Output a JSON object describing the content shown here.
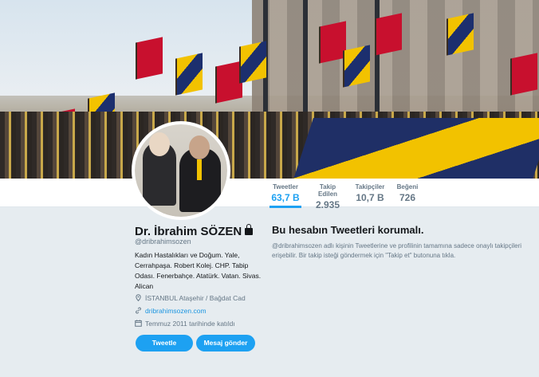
{
  "colors": {
    "accent": "#1da1f2",
    "link": "#1b95e0",
    "page_background": "#e6ecf0",
    "muted_text": "#657786"
  },
  "nav": {
    "stats": [
      {
        "label": "Tweetler",
        "value": "63,7 B",
        "active": true
      },
      {
        "label": "Takip Edilen",
        "value": "2.935",
        "active": false
      },
      {
        "label": "Takipçiler",
        "value": "10,7 B",
        "active": false
      },
      {
        "label": "Beğeni",
        "value": "726",
        "active": false
      }
    ]
  },
  "profile": {
    "name": "Dr. İbrahim SÖZEN",
    "handle": "@dribrahimsozen",
    "bio": "Kadın Hastalıkları ve Doğum. Yale, Cerrahpaşa. Robert Kolej. CHP. Tabip Odası. Fenerbahçe. Atatürk. Vatan. Sivas. Alican",
    "location": "İSTANBUL Ataşehir / Bağdat Cad",
    "website": "dribrahimsozen.com",
    "joined": "Temmuz 2011 tarihinde katıldı",
    "icons": {
      "protected": "lock-icon",
      "location": "location-pin-icon",
      "website": "link-icon",
      "joined": "calendar-icon"
    }
  },
  "buttons": {
    "tweet_label": "Tweetle",
    "message_label": "Mesaj gönder"
  },
  "protected": {
    "title": "Bu hesabın Tweetleri korumalı.",
    "description": "@dribrahimsozen adlı kişinin Tweetlerine ve profilinin tamamına sadece onaylı takipçileri erişebilir. Bir takip isteği göndermek için \"Takip et\" butonuna tıkla."
  }
}
